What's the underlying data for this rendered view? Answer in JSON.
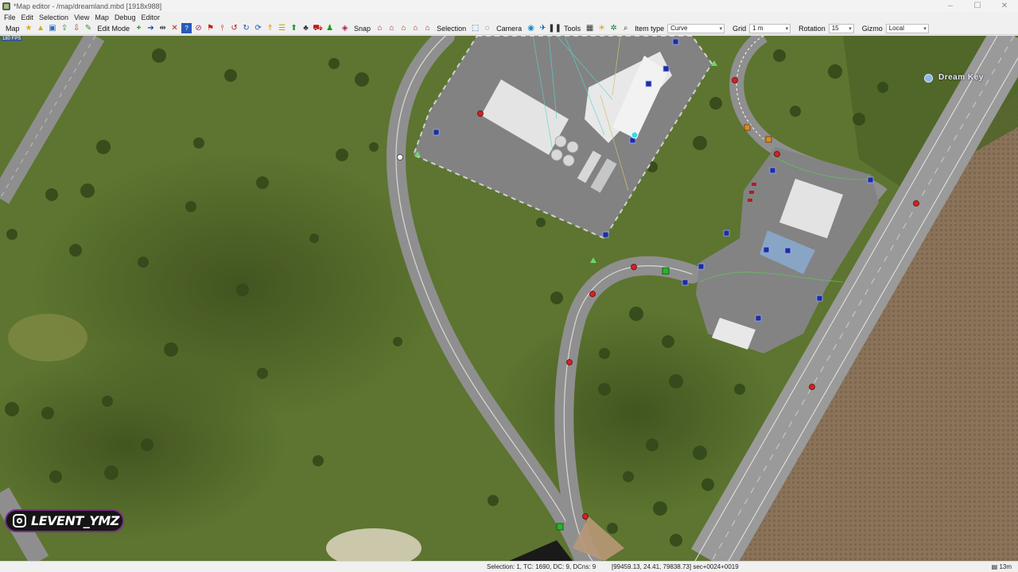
{
  "window": {
    "title": "*Map editor - /map/dreamland.mbd [1918x988]",
    "controls": [
      "–",
      "☐",
      "✕"
    ]
  },
  "menu": [
    "File",
    "Edit",
    "Selection",
    "View",
    "Map",
    "Debug",
    "Editor"
  ],
  "toolbar": {
    "map_label": "Map",
    "edit_mode_label": "Edit Mode",
    "snap_label": "Snap",
    "selection_label": "Selection",
    "camera_label": "Camera",
    "tools_label": "Tools",
    "item_type_label": "Item type",
    "item_type_value": "Curve",
    "grid_label": "Grid",
    "grid_value": "1 m",
    "rotation_label": "Rotation",
    "rotation_value": "15",
    "gizmo_label": "Gizmo",
    "gizmo_value": "Local"
  },
  "viewport": {
    "fps": "180 FPS",
    "location_label": "Dream Key"
  },
  "watermark": {
    "text": "LEVENT_YMZ"
  },
  "status": {
    "selection": "Selection: 1, TC: 1690, DC: 9, DCns: 9",
    "coords": "[99459.13, 24.41, 79838.73] sec+0024+0019",
    "zoom": "13m"
  },
  "colors": {
    "grass": "#58702a",
    "road": "#a8a8a8",
    "node_red": "#d62020",
    "node_blue": "#1f2e9a",
    "node_green": "#28b428"
  }
}
